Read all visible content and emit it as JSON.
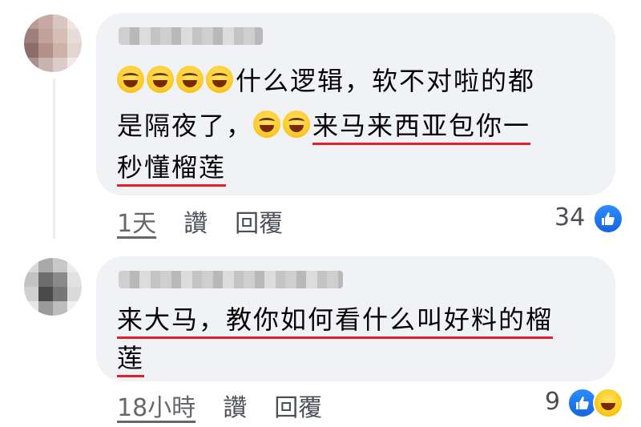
{
  "comments": [
    {
      "line1": "什么逻辑，软不对啦的都",
      "line2_plain": "是隔夜了，",
      "line2_underlined": "来马来西亚包你一",
      "line3_underlined": "秒懂榴莲",
      "time": "1天",
      "like_label": "讚",
      "reply_label": "回覆",
      "reaction_count": "34",
      "reactions": [
        "like-icon"
      ]
    },
    {
      "line1_underlined": "来大马，教你如何看什么叫好料的榴",
      "line2_underlined": "莲",
      "time": "18小時",
      "like_label": "讚",
      "reply_label": "回覆",
      "reaction_count": "9",
      "reactions": [
        "like-icon",
        "haha-icon"
      ]
    }
  ],
  "colors": {
    "bubble": "#f0f2f5",
    "underline": "#e0202a",
    "like_blue": "#1877f2",
    "meta_gray": "#65676b"
  }
}
